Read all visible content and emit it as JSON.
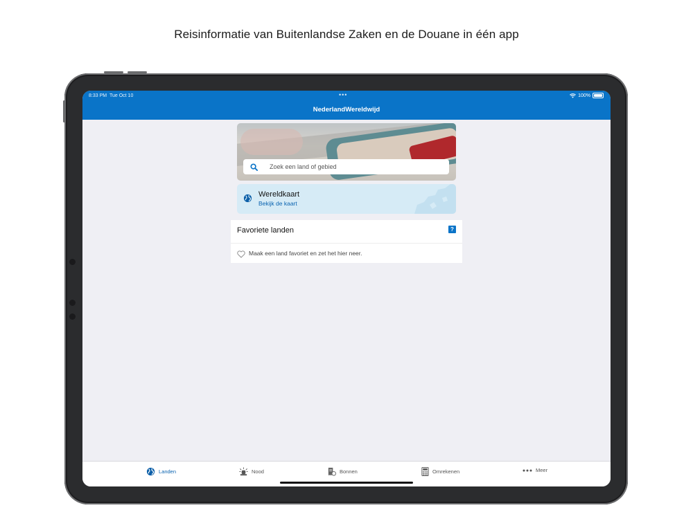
{
  "headline": "Reisinformatie van Buitenlandse Zaken en de Douane in één app",
  "status": {
    "time": "8:33 PM",
    "date": "Tue Oct 10",
    "dots": "•••",
    "battery": "100%"
  },
  "nav": {
    "title": "NederlandWereldwijd"
  },
  "search": {
    "placeholder": "Zoek een land of gebied"
  },
  "world_map": {
    "title": "Wereldkaart",
    "subtitle": "Bekijk de kaart"
  },
  "favorites": {
    "title": "Favoriete landen",
    "help": "?",
    "empty": "Maak een land favoriet en zet het hier neer."
  },
  "tabs": [
    {
      "label": "Landen",
      "icon": "globe-icon"
    },
    {
      "label": "Nood",
      "icon": "siren-icon"
    },
    {
      "label": "Bonnen",
      "icon": "receipt-icon"
    },
    {
      "label": "Omrekenen",
      "icon": "calculator-icon"
    },
    {
      "label": "Meer",
      "icon": "more-icon"
    }
  ],
  "colors": {
    "brand": "#0a74c8",
    "link": "#0a63b0",
    "background": "#efeff4",
    "card": "#d6ebf6"
  }
}
